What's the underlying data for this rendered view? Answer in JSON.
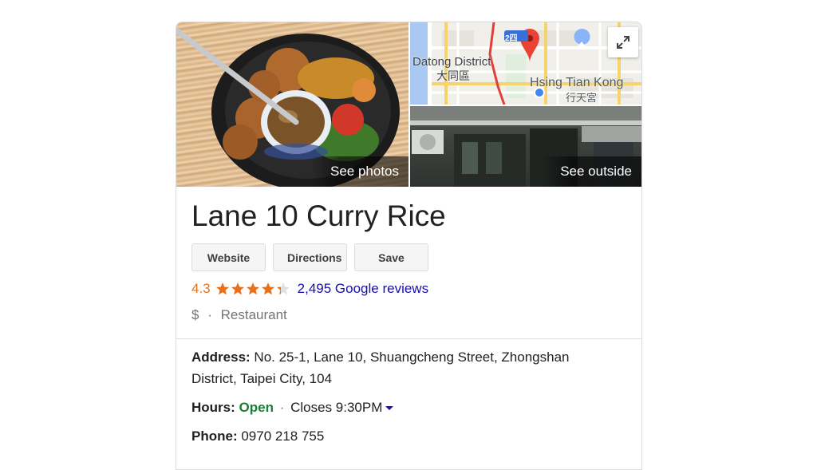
{
  "media": {
    "see_photos": "See photos",
    "see_outside": "See outside",
    "map": {
      "district_en": "Datong District",
      "district_zh": "大同區",
      "temple_en": "Hsing Tian Kong",
      "temple_zh": "行天宮",
      "route_badge": "2四"
    }
  },
  "place": {
    "title": "Lane 10 Curry Rice",
    "actions": {
      "website": "Website",
      "directions": "Directions",
      "save": "Save"
    },
    "rating": "4.3",
    "rating_stars": 4.3,
    "reviews": "2,495 Google reviews",
    "price": "$",
    "separator": "·",
    "category": "Restaurant"
  },
  "details": {
    "address_label": "Address:",
    "address_line1": "No. 25-1, Lane 10, Shuangcheng Street, Zhongshan",
    "address_line2": "District, Taipei City, 104",
    "hours_label": "Hours:",
    "hours_status": "Open",
    "hours_sep": "·",
    "hours_close": "Closes 9:30PM",
    "phone_label": "Phone:",
    "phone": "0970 218 755"
  },
  "colors": {
    "rating": "#e7711b",
    "link": "#1a0dab",
    "open": "#188038",
    "pin": "#ea4335"
  }
}
